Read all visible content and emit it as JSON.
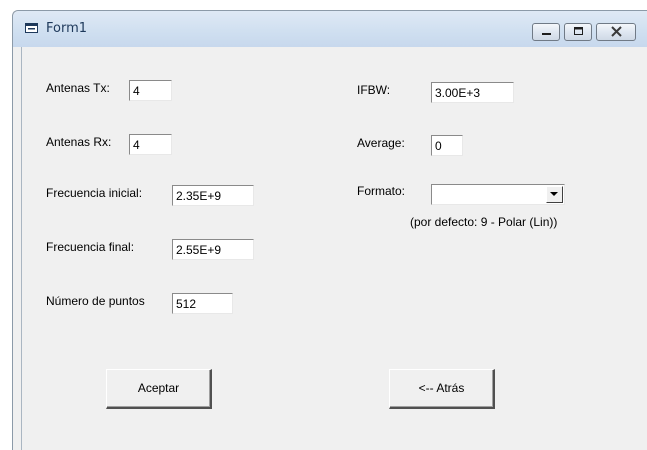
{
  "window": {
    "title": "Form1"
  },
  "form": {
    "antenas_tx": {
      "label": "Antenas Tx:",
      "value": "4"
    },
    "antenas_rx": {
      "label": "Antenas Rx:",
      "value": "4"
    },
    "frecuencia_inicial": {
      "label": "Frecuencia inicial:",
      "value": "2.35E+9"
    },
    "frecuencia_final": {
      "label": "Frecuencia final:",
      "value": "2.55E+9"
    },
    "numero_puntos": {
      "label": "Número de puntos",
      "value": "512"
    },
    "ifbw": {
      "label": "IFBW:",
      "value": "3.00E+3"
    },
    "average": {
      "label": "Average:",
      "value": "0"
    },
    "formato": {
      "label": "Formato:",
      "value": "",
      "hint": "(por defecto: 9 - Polar (Lin))"
    }
  },
  "buttons": {
    "accept": "Aceptar",
    "back": "<-- Atrás"
  }
}
